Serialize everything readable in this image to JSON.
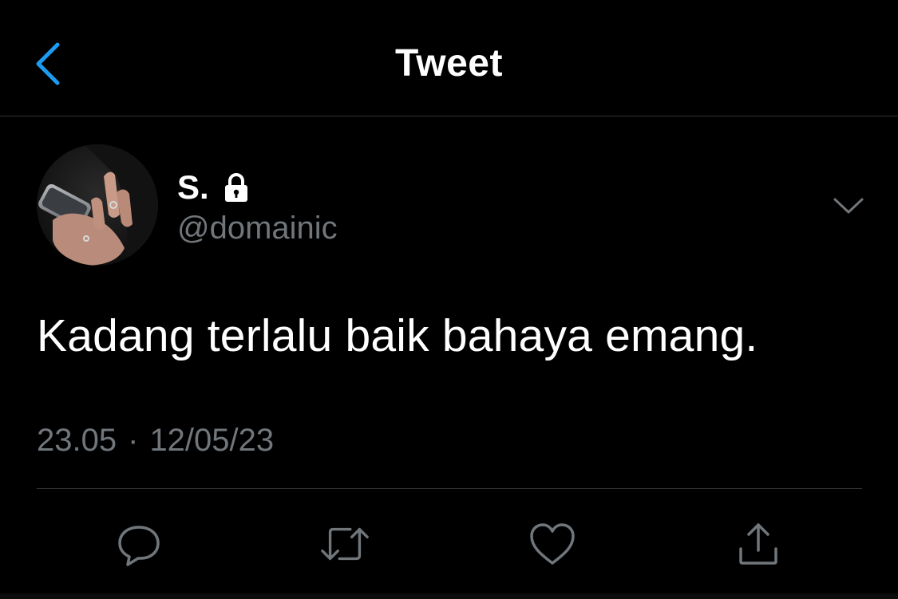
{
  "header": {
    "title": "Tweet",
    "back_icon": "chevron-left-icon"
  },
  "author": {
    "display_name": "S.",
    "handle": "@domainic",
    "protected_icon": "lock-icon"
  },
  "tweet": {
    "text": "Kadang terlalu baik bahaya emang.",
    "time": "23.05",
    "separator": "·",
    "date": "12/05/23"
  },
  "actions": {
    "reply_icon": "reply-icon",
    "retweet_icon": "retweet-icon",
    "like_icon": "heart-icon",
    "share_icon": "share-icon"
  },
  "colors": {
    "background": "#000000",
    "text": "#ffffff",
    "muted": "#71767b",
    "accent": "#1d9bf0",
    "divider": "#2f3336"
  }
}
